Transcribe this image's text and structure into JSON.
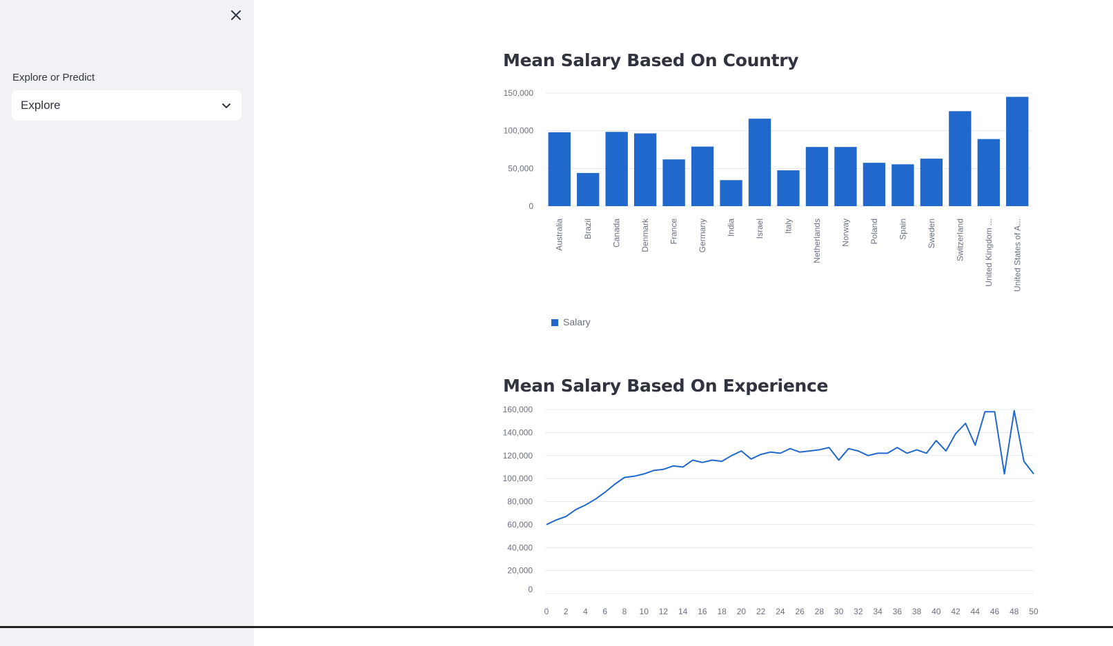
{
  "sidebar": {
    "select_label": "Explore or Predict",
    "select_value": "Explore"
  },
  "colors": {
    "bar": "#2068cc",
    "line": "#2068cc",
    "axis_text": "#6b7080",
    "grid": "#e6e8ee"
  },
  "icons": {
    "close": "close-icon",
    "chevron": "chevron-down-icon"
  },
  "chart_data": [
    {
      "type": "bar",
      "title": "Mean Salary Based On Country",
      "categories": [
        "Australia",
        "Brazil",
        "Canada",
        "Denmark",
        "France",
        "Germany",
        "India",
        "Israel",
        "Italy",
        "Netherlands",
        "Norway",
        "Poland",
        "Spain",
        "Sweden",
        "Switzerland",
        "United Kingdom ...",
        "United States of A..."
      ],
      "series": [
        {
          "name": "Salary",
          "values": [
            98000,
            44000,
            98500,
            96500,
            62000,
            79000,
            34500,
            116000,
            47500,
            78500,
            78500,
            57500,
            55500,
            63000,
            126000,
            89000,
            145000
          ]
        }
      ],
      "yticks": [
        "0",
        "50,000",
        "100,000",
        "150,000"
      ],
      "ylim": [
        0,
        150000
      ],
      "legend": "bottom-left",
      "grid": true
    },
    {
      "type": "line",
      "title": "Mean Salary Based On Experience",
      "x": [
        0,
        1,
        2,
        3,
        4,
        5,
        6,
        7,
        8,
        9,
        10,
        11,
        12,
        13,
        14,
        15,
        16,
        17,
        18,
        19,
        20,
        21,
        22,
        23,
        24,
        25,
        26,
        27,
        28,
        29,
        30,
        31,
        32,
        33,
        34,
        35,
        36,
        37,
        38,
        39,
        40,
        41,
        42,
        43,
        44,
        45,
        46,
        47,
        48,
        49,
        50
      ],
      "series": [
        {
          "values": [
            60000,
            64000,
            67000,
            73000,
            77000,
            82000,
            88000,
            95000,
            101000,
            102000,
            104000,
            107000,
            108000,
            111000,
            110000,
            116000,
            114000,
            116000,
            115000,
            120000,
            124000,
            117000,
            121000,
            123000,
            122000,
            126000,
            123000,
            124000,
            125000,
            127000,
            116000,
            126000,
            124000,
            120000,
            122000,
            122000,
            127000,
            122000,
            125000,
            122000,
            133000,
            124000,
            139000,
            148000,
            129000,
            158000,
            158000,
            104000,
            159000,
            115000,
            104000
          ]
        }
      ],
      "xticks": [
        "0",
        "2",
        "4",
        "6",
        "8",
        "10",
        "12",
        "14",
        "16",
        "18",
        "20",
        "22",
        "24",
        "26",
        "28",
        "30",
        "32",
        "34",
        "36",
        "38",
        "40",
        "42",
        "44",
        "46",
        "48",
        "50"
      ],
      "yticks": [
        "0",
        "20,000",
        "40,000",
        "60,000",
        "80,000",
        "100,000",
        "120,000",
        "140,000",
        "160,000"
      ],
      "xlim": [
        0,
        50
      ],
      "ylim": [
        0,
        160000
      ],
      "grid": true
    }
  ]
}
